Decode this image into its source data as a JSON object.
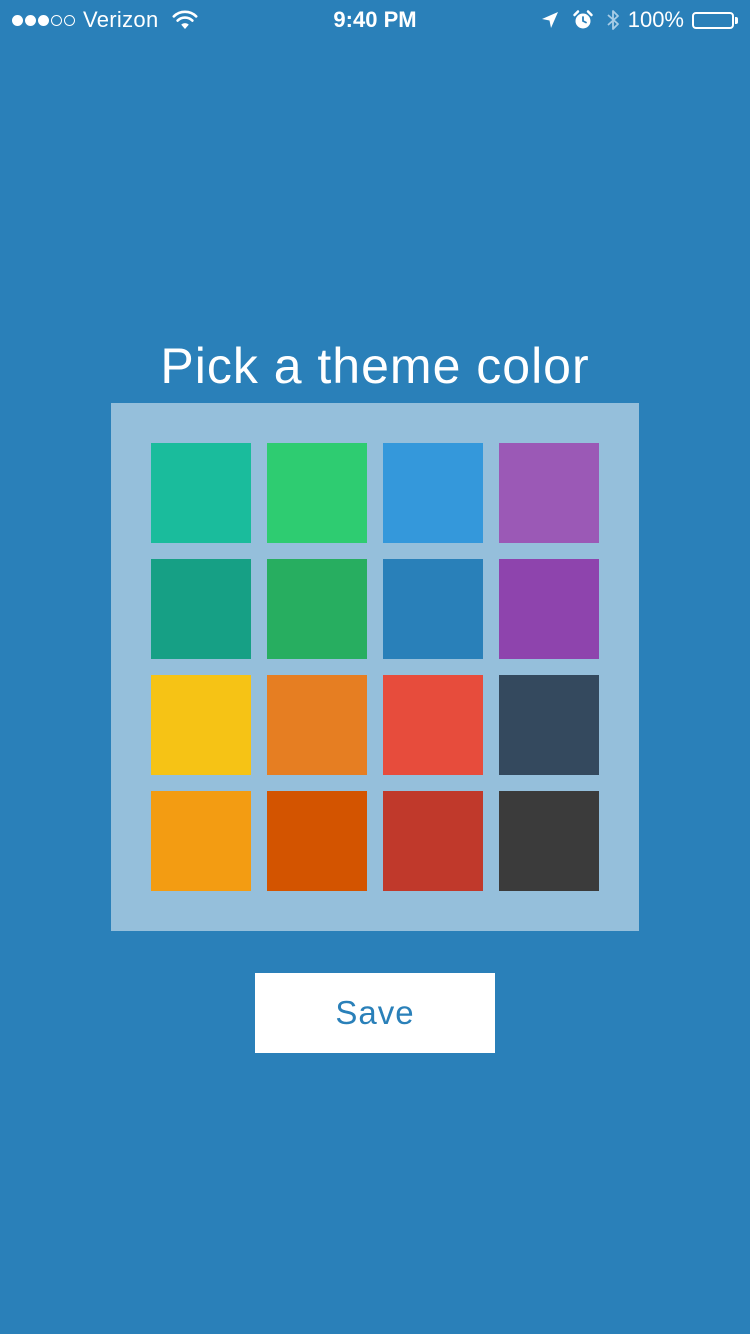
{
  "status_bar": {
    "carrier": "Verizon",
    "signal_bars_filled": 3,
    "signal_bars_total": 5,
    "time": "9:40 PM",
    "battery_percent": "100%",
    "battery_level": 1.0,
    "icons": [
      "wifi-icon",
      "location-arrow-icon",
      "alarm-clock-icon",
      "bluetooth-icon",
      "battery-icon"
    ]
  },
  "picker": {
    "title": "Pick a theme color",
    "swatches": [
      {
        "name": "turquoise",
        "color": "#1abc9c"
      },
      {
        "name": "emerald",
        "color": "#2ecc71"
      },
      {
        "name": "peter-river",
        "color": "#3498db"
      },
      {
        "name": "amethyst",
        "color": "#9b59b6"
      },
      {
        "name": "green-sea",
        "color": "#16a085"
      },
      {
        "name": "nephritis",
        "color": "#27ae60"
      },
      {
        "name": "belize-hole",
        "color": "#2980b9"
      },
      {
        "name": "wisteria",
        "color": "#8e44ad"
      },
      {
        "name": "sunflower",
        "color": "#f6c315"
      },
      {
        "name": "carrot",
        "color": "#e67e22"
      },
      {
        "name": "alizarin",
        "color": "#e74c3c"
      },
      {
        "name": "wet-asphalt",
        "color": "#34495e"
      },
      {
        "name": "orange",
        "color": "#f39c12"
      },
      {
        "name": "pumpkin",
        "color": "#d35400"
      },
      {
        "name": "pomegranate",
        "color": "#c0392b"
      },
      {
        "name": "charcoal",
        "color": "#3b3b3b"
      }
    ],
    "save_label": "Save"
  },
  "colors": {
    "background": "#2a80b9",
    "panel": "#95bfdb",
    "button_bg": "#ffffff",
    "button_text": "#2a80b9"
  }
}
